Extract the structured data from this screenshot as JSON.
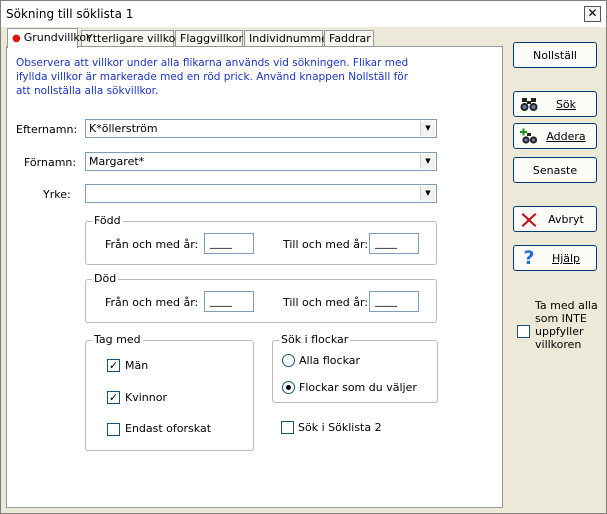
{
  "window": {
    "title": "Sökning till söklista 1",
    "close_symbol": "✕"
  },
  "tabs": [
    {
      "label": "Grundvillkor",
      "marked": true
    },
    {
      "label": "Ytterligare villkor"
    },
    {
      "label": "Flaggvillkor"
    },
    {
      "label": "Individnummer"
    },
    {
      "label": "Faddrar"
    }
  ],
  "info_text": "Observera att villkor under alla flikarna används vid sökningen. Flikar med ifyllda villkor är markerade med en röd prick. Använd knappen Nollställ för att nollställa alla sökvillkor.",
  "fields": {
    "surname": {
      "label": "Efternamn:",
      "value": "K*öllerström"
    },
    "firstname": {
      "label": "Förnamn:",
      "value": "Margaret*"
    },
    "occupation": {
      "label": "Yrke:",
      "value": ""
    }
  },
  "born": {
    "legend": "Född",
    "from_label": "Från och med år:",
    "from_value": "____",
    "to_label": "Till och med år:",
    "to_value": "____"
  },
  "died": {
    "legend": "Död",
    "from_label": "Från och med år:",
    "from_value": "____",
    "to_label": "Till och med år:",
    "to_value": "____"
  },
  "include": {
    "legend": "Tag med",
    "men": {
      "label": "Män",
      "checked": true
    },
    "women": {
      "label": "Kvinnor",
      "checked": true
    },
    "unresearched": {
      "label": "Endast oforskat",
      "checked": false
    }
  },
  "flocks": {
    "legend": "Sök i flockar",
    "all": {
      "label": "Alla flockar",
      "selected": false
    },
    "chosen": {
      "label": "Flockar som du väljer",
      "selected": true
    }
  },
  "search_list2": {
    "label": "Sök i Söklista 2",
    "checked": false
  },
  "check_mark": "✓",
  "buttons": {
    "reset": "Nollställ",
    "search": "Sök",
    "add": "Addera",
    "recent": "Senaste",
    "cancel": "Avbryt",
    "help": "Hjälp"
  },
  "include_non_matching": {
    "label": "Ta med alla som INTE uppfyller villkoren",
    "checked": false
  },
  "colors": {
    "info_text": "#1b35c4",
    "tab_marker": "#dd1111",
    "cancel_icon": "#c0161a",
    "help_icon": "#2d6bd9"
  },
  "icons": {
    "dropdown": "▼"
  }
}
